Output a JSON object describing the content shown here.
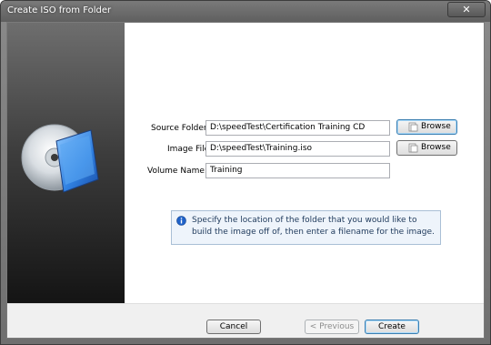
{
  "window": {
    "title": "Create ISO from Folder",
    "close_glyph": "✕"
  },
  "form": {
    "source_folder": {
      "label": "Source Folder:",
      "value": "D:\\speedTest\\Certification Training CD",
      "browse_label": "Browse"
    },
    "image_file": {
      "label": "Image File:",
      "value": "D:\\speedTest\\Training.iso",
      "browse_label": "Browse"
    },
    "volume_name": {
      "label": "Volume Name:",
      "value": "Training"
    }
  },
  "info": {
    "icon": "info-icon",
    "text": "Specify the location of the folder that you would like to build the image off of, then enter a filename for the image."
  },
  "buttons": {
    "cancel": "Cancel",
    "previous": "< Previous",
    "create": "Create"
  },
  "colors": {
    "accent": "#3c7fb1",
    "info_bg": "#eef4fb",
    "info_text": "#1e395b"
  }
}
